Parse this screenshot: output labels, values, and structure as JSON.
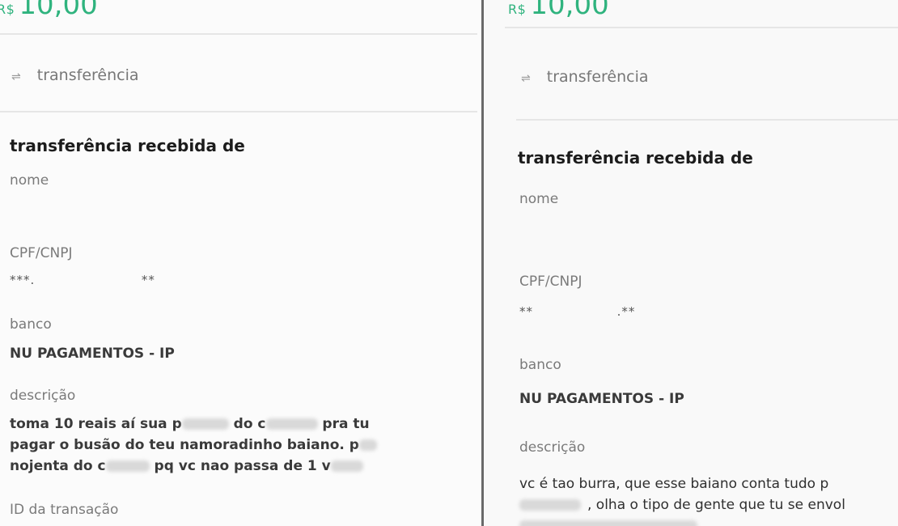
{
  "left": {
    "amount_currency": "R$",
    "amount_value": "10,00",
    "type_label": "transferência",
    "section_title": "transferência recebida de",
    "name_label": "nome",
    "doc_label": "CPF/CNPJ",
    "doc_value_a": "***.",
    "doc_value_b": "**",
    "bank_label": "banco",
    "bank_value": "NU PAGAMENTOS - IP",
    "desc_label": "descrição",
    "desc_line1_a": "toma 10 reais aí sua p",
    "desc_line1_b": "do c",
    "desc_line1_c": "pra tu",
    "desc_line2_a": "pagar o busão do teu namoradinho baiano. p",
    "desc_line3_a": "nojenta do c",
    "desc_line3_b": "pq vc nao passa de 1 v",
    "id_label": "ID da transação"
  },
  "right": {
    "amount_currency": "R$",
    "amount_value": "10,00",
    "type_label": "transferência",
    "section_title": "transferência recebida de",
    "name_label": "nome",
    "doc_label": "CPF/CNPJ",
    "doc_value_a": "**",
    "doc_value_b": ".**",
    "bank_label": "banco",
    "bank_value": "NU PAGAMENTOS - IP",
    "desc_label": "descrição",
    "desc_line1": "vc é tao burra, que esse baiano conta tudo p",
    "desc_line2": ", olha o tipo de gente que tu se envol"
  },
  "icons": {
    "transfer": "transfer-arrows-icon"
  },
  "colors": {
    "accent": "#2fb37e"
  }
}
